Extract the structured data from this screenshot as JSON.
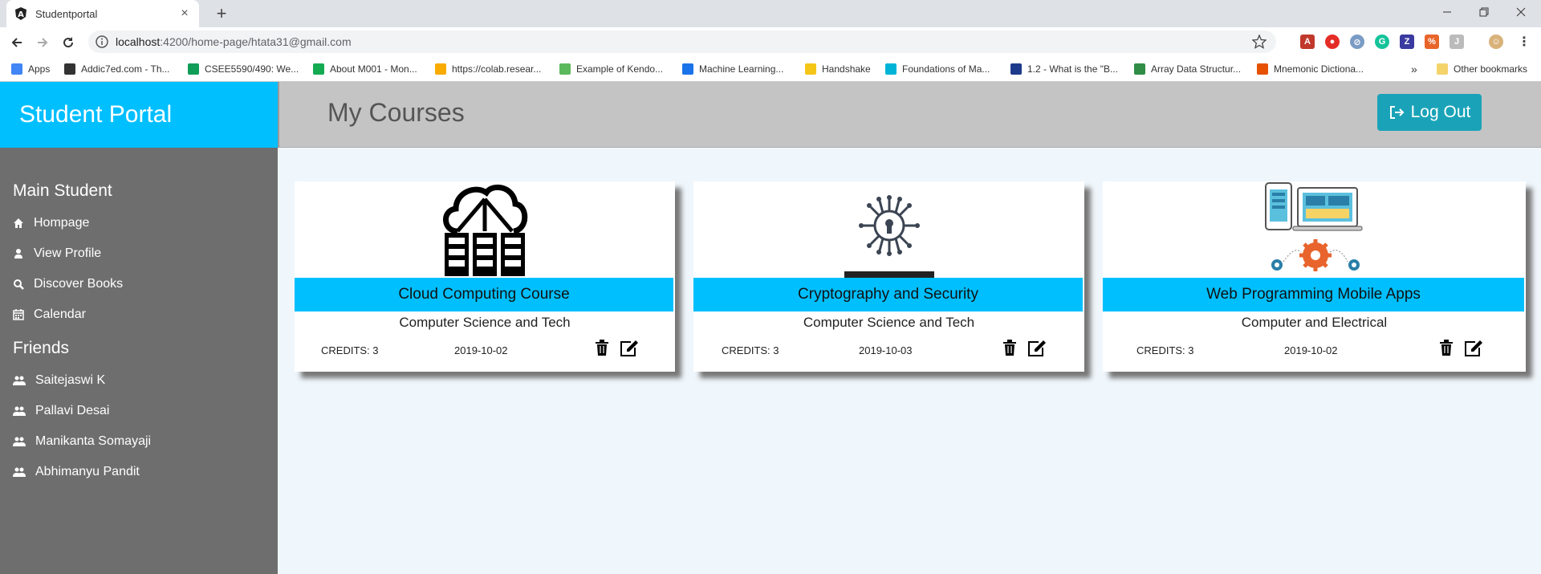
{
  "browser": {
    "tab_title": "Studentportal",
    "url_host": "localhost",
    "url_path": ":4200/home-page/htata31@gmail.com",
    "bookmarks": [
      {
        "label": "Apps",
        "color": "#4285f4"
      },
      {
        "label": "Addic7ed.com - Th...",
        "color": "#333333"
      },
      {
        "label": "CSEE5590/490: We...",
        "color": "#0f9d58"
      },
      {
        "label": "About M001 - Mon...",
        "color": "#13aa52"
      },
      {
        "label": "https://colab.resear...",
        "color": "#f9ab00"
      },
      {
        "label": "Example of Kendo...",
        "color": "#5cb85c"
      },
      {
        "label": "Machine Learning...",
        "color": "#1a73e8"
      },
      {
        "label": "Handshake",
        "color": "#f5c518"
      },
      {
        "label": "Foundations of Ma...",
        "color": "#00b4d8"
      },
      {
        "label": "1.2 - What is the \"B...",
        "color": "#1e3a8a"
      },
      {
        "label": "Array Data Structur...",
        "color": "#2f8d46"
      },
      {
        "label": "Mnemonic Dictiona...",
        "color": "#e65100"
      }
    ],
    "other_bookmarks": "Other bookmarks",
    "more": "»"
  },
  "header": {
    "brand": "Student Portal",
    "page_title": "My Courses",
    "logout_label": "Log Out"
  },
  "sidebar": {
    "main_heading": "Main Student",
    "main_items": [
      {
        "label": "Hompage",
        "icon": "home-icon"
      },
      {
        "label": "View Profile",
        "icon": "user-icon"
      },
      {
        "label": "Discover Books",
        "icon": "search-icon"
      },
      {
        "label": "Calendar",
        "icon": "calendar-icon"
      }
    ],
    "friends_heading": "Friends",
    "friends": [
      {
        "label": "Saitejaswi K"
      },
      {
        "label": "Pallavi Desai"
      },
      {
        "label": "Manikanta Somayaji"
      },
      {
        "label": "Abhimanyu Pandit"
      }
    ]
  },
  "courses": [
    {
      "title": "Cloud Computing Course",
      "department": "Computer Science and Tech",
      "credits": "CREDITS: 3",
      "date": "2019-10-02",
      "image": "cloud-computing-image"
    },
    {
      "title": "Cryptography and Security",
      "department": "Computer Science and Tech",
      "credits": "CREDITS: 3",
      "date": "2019-10-03",
      "image": "cryptography-image"
    },
    {
      "title": "Web Programming Mobile Apps",
      "department": "Computer and Electrical",
      "credits": "CREDITS: 3",
      "date": "2019-10-02",
      "image": "web-mobile-image"
    }
  ],
  "colors": {
    "brand": "#00bfff",
    "sidebar": "#6e6e6e",
    "header": "#c4c4c4",
    "logout": "#1aa3b8"
  }
}
